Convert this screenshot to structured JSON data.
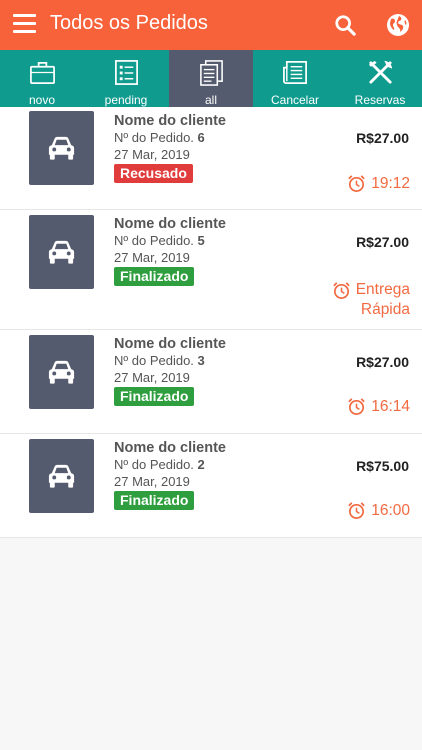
{
  "header": {
    "title": "Todos os Pedidos",
    "menu_icon": "hamburger-menu-icon",
    "search_icon": "search-icon",
    "globe_icon": "globe-icon",
    "background": "#f7623b"
  },
  "tabs": [
    {
      "label": "novo",
      "icon": "briefcase-icon"
    },
    {
      "label": "pending",
      "icon": "checklist-icon"
    },
    {
      "label": "all",
      "icon": "documents-icon",
      "active": true
    },
    {
      "label": "Cancelar",
      "icon": "newspaper-icon"
    },
    {
      "label": "Reservas",
      "icon": "fork-knife-icon"
    }
  ],
  "tab_colors": {
    "bar": "#0f9b8e",
    "active": "#555b6e"
  },
  "orders": [
    {
      "customer": "Nome do cliente",
      "order_prefix": "Nº do Pedido.",
      "order_number": "6",
      "date": "27 Mar, 2019",
      "status": "Recusado",
      "status_color": "#e13c3c",
      "price": "R$27.00",
      "time_lines": [
        "19:12"
      ]
    },
    {
      "customer": "Nome do cliente",
      "order_prefix": "Nº do Pedido.",
      "order_number": "5",
      "date": "27 Mar, 2019",
      "status": "Finalizado",
      "status_color": "#2f9e3f",
      "price": "R$27.00",
      "time_lines": [
        "Entrega",
        "Rápida"
      ]
    },
    {
      "customer": "Nome do cliente",
      "order_prefix": "Nº do Pedido.",
      "order_number": "3",
      "date": "27 Mar, 2019",
      "status": "Finalizado",
      "status_color": "#2f9e3f",
      "price": "R$27.00",
      "time_lines": [
        "16:14"
      ]
    },
    {
      "customer": "Nome do cliente",
      "order_prefix": "Nº do Pedido.",
      "order_number": "2",
      "date": "27 Mar, 2019",
      "status": "Finalizado",
      "status_color": "#2f9e3f",
      "price": "R$75.00",
      "time_lines": [
        "16:00"
      ]
    }
  ]
}
